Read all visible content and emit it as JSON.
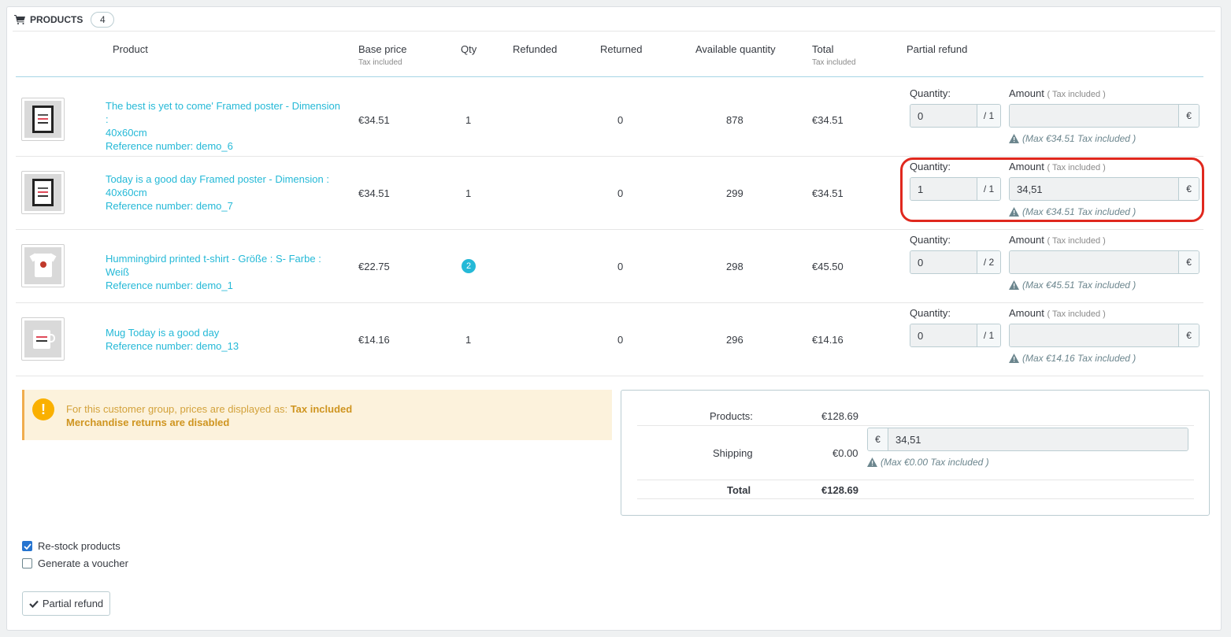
{
  "panel": {
    "title": "Products",
    "count": "4"
  },
  "table": {
    "headers": {
      "product": "Product",
      "base_price": "Base price",
      "base_price_sub": "Tax included",
      "qty": "Qty",
      "refunded": "Refunded",
      "returned": "Returned",
      "available": "Available quantity",
      "total": "Total",
      "total_sub": "Tax included",
      "partial_refund": "Partial refund"
    },
    "rows": [
      {
        "name_line1": "The best is yet to come' Framed poster - Dimension :",
        "name_line2": "40x60cm",
        "reference": "Reference number: demo_6",
        "base_price": "€34.51",
        "qty": "1",
        "refunded": "",
        "returned": "0",
        "available": "878",
        "total": "€34.51",
        "refund_qty_label": "Quantity:",
        "refund_qty_value": "0",
        "refund_qty_max": "/ 1",
        "amount_label": "Amount",
        "amount_sub": "( Tax included )",
        "amount_value": "",
        "currency": "€",
        "max_note": "(Max €34.51 Tax included )"
      },
      {
        "name_line1": "Today is a good day Framed poster - Dimension :",
        "name_line2": "40x60cm",
        "reference": "Reference number: demo_7",
        "base_price": "€34.51",
        "qty": "1",
        "refunded": "",
        "returned": "0",
        "available": "299",
        "total": "€34.51",
        "refund_qty_label": "Quantity:",
        "refund_qty_value": "1",
        "refund_qty_max": "/ 1",
        "amount_label": "Amount",
        "amount_sub": "( Tax included )",
        "amount_value": "34,51",
        "currency": "€",
        "max_note": "(Max €34.51 Tax included )"
      },
      {
        "name_line1": "Hummingbird printed t-shirt - Größe : S- Farbe : Weiß",
        "name_line2": "",
        "reference": "Reference number: demo_1",
        "base_price": "€22.75",
        "qty": "2",
        "refunded": "",
        "returned": "0",
        "available": "298",
        "total": "€45.50",
        "refund_qty_label": "Quantity:",
        "refund_qty_value": "0",
        "refund_qty_max": "/ 2",
        "amount_label": "Amount",
        "amount_sub": "( Tax included )",
        "amount_value": "",
        "currency": "€",
        "max_note": "(Max €45.51 Tax included )"
      },
      {
        "name_line1": "Mug Today is a good day",
        "name_line2": "",
        "reference": "Reference number: demo_13",
        "base_price": "€14.16",
        "qty": "1",
        "refunded": "",
        "returned": "0",
        "available": "296",
        "total": "€14.16",
        "refund_qty_label": "Quantity:",
        "refund_qty_value": "0",
        "refund_qty_max": "/ 1",
        "amount_label": "Amount",
        "amount_sub": "( Tax included )",
        "amount_value": "",
        "currency": "€",
        "max_note": "(Max €14.16 Tax included )"
      }
    ]
  },
  "alert": {
    "line1_prefix": "For this customer group, prices are displayed as:",
    "line1_bold": "Tax included",
    "line2": "Merchandise returns are disabled"
  },
  "totals": {
    "products_label": "Products:",
    "products_value": "€128.69",
    "shipping_label": "Shipping",
    "shipping_value": "€0.00",
    "shipping_currency": "€",
    "shipping_refund_value": "34,51",
    "shipping_max_note": "(Max €0.00 Tax included )",
    "total_label": "Total",
    "total_value": "€128.69"
  },
  "options": {
    "restock_label": "Re-stock products",
    "restock_checked": true,
    "voucher_label": "Generate a voucher",
    "voucher_checked": false
  },
  "actions": {
    "partial_refund_label": "Partial refund"
  },
  "colors": {
    "link": "#25b9d7",
    "highlight": "#e0281e",
    "warning": "#fab000"
  }
}
